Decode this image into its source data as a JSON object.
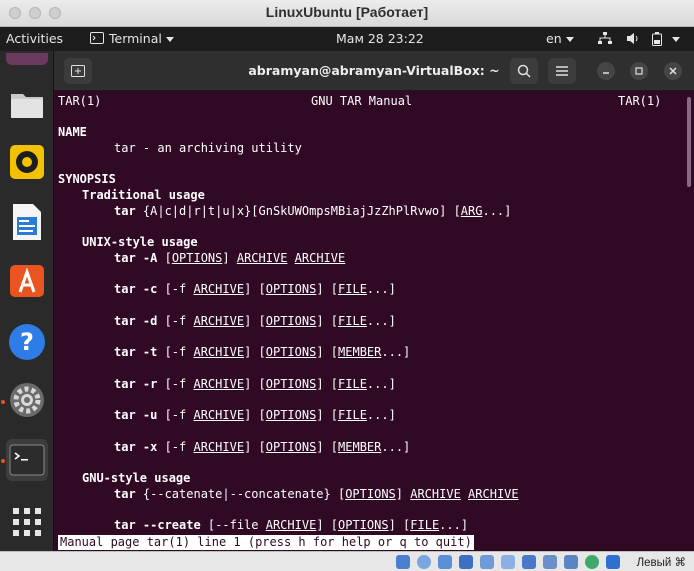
{
  "window": {
    "title": "LinuxUbuntu [Работает]"
  },
  "topbar": {
    "activities": "Activities",
    "app_menu": "Terminal",
    "clock": "Мам 28  23:22",
    "language": "en"
  },
  "dock": {
    "items": [
      "files",
      "rhythmbox",
      "libreoffice-writer",
      "ubuntu-software",
      "help",
      "settings",
      "terminal",
      "show-applications"
    ]
  },
  "terminal": {
    "title": "abramyan@abramyan-VirtualBox: ~",
    "man": {
      "header_left": "TAR(1)",
      "header_center": "GNU TAR Manual",
      "header_right": "TAR(1)",
      "name_heading": "NAME",
      "name_desc": "tar - an archiving utility",
      "synopsis_heading": "SYNOPSIS",
      "traditional_heading": "Traditional usage",
      "traditional_cmd": "tar",
      "traditional_opts": " {A|c|d|r|t|u|x}[GnSkUWOmpsMBiajJzZhPlRvwo] [",
      "traditional_arg": "ARG",
      "traditional_end": "...]",
      "unix_heading": "UNIX-style usage",
      "unix_a_cmd": "tar -A",
      "unix_a_opt": "OPTIONS",
      "unix_a_archive1": "ARCHIVE",
      "unix_a_archive2": "ARCHIVE",
      "unix_lines": [
        {
          "cmd": "tar -c",
          "pre": " [-f ",
          "archive": "ARCHIVE",
          "mid1": "] [",
          "opt": "OPTIONS",
          "mid2": "] [",
          "target": "FILE",
          "end": "...]"
        },
        {
          "cmd": "tar -d",
          "pre": " [-f ",
          "archive": "ARCHIVE",
          "mid1": "] [",
          "opt": "OPTIONS",
          "mid2": "] [",
          "target": "FILE",
          "end": "...]"
        },
        {
          "cmd": "tar -t",
          "pre": " [-f ",
          "archive": "ARCHIVE",
          "mid1": "] [",
          "opt": "OPTIONS",
          "mid2": "] [",
          "target": "MEMBER",
          "end": "...]"
        },
        {
          "cmd": "tar -r",
          "pre": " [-f ",
          "archive": "ARCHIVE",
          "mid1": "] [",
          "opt": "OPTIONS",
          "mid2": "] [",
          "target": "FILE",
          "end": "...]"
        },
        {
          "cmd": "tar -u",
          "pre": " [-f ",
          "archive": "ARCHIVE",
          "mid1": "] [",
          "opt": "OPTIONS",
          "mid2": "] [",
          "target": "FILE",
          "end": "...]"
        },
        {
          "cmd": "tar -x",
          "pre": " [-f ",
          "archive": "ARCHIVE",
          "mid1": "] [",
          "opt": "OPTIONS",
          "mid2": "] [",
          "target": "MEMBER",
          "end": "...]"
        }
      ],
      "gnu_heading": "GNU-style usage",
      "gnu_cat_cmd": "tar",
      "gnu_cat_opts": " {--catenate|--concatenate} [",
      "gnu_cat_opt": "OPTIONS",
      "gnu_cat_archive1": "ARCHIVE",
      "gnu_cat_archive2": "ARCHIVE",
      "gnu_create_cmd": "tar --create",
      "gnu_create_pre": " [--file ",
      "gnu_create_archive": "ARCHIVE",
      "gnu_create_opt": "OPTIONS",
      "gnu_create_file": "FILE",
      "status": "Manual page tar(1) line 1 (press h for help or q to quit)"
    }
  },
  "vbox_status": {
    "host_key": "Левый ⌘"
  },
  "colors": {
    "terminal_bg": "#300a24",
    "accent": "#e95420"
  }
}
